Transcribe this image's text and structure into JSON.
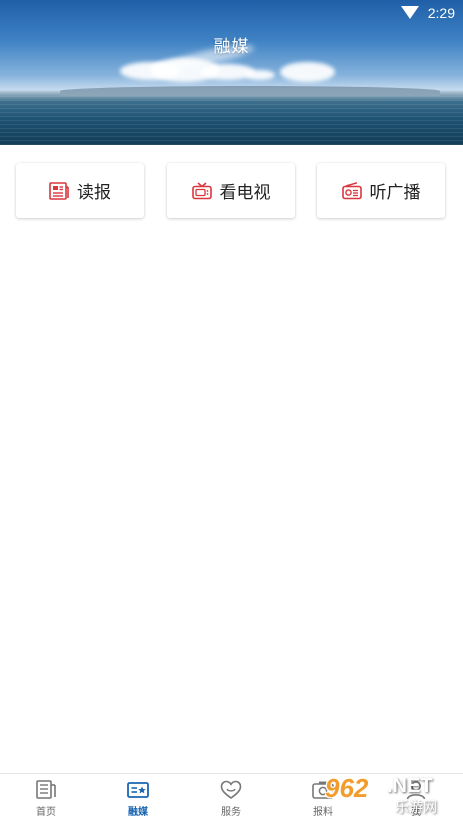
{
  "status_bar": {
    "time": "2:29",
    "wifi_icon": "wifi-icon"
  },
  "header": {
    "title": "融媒"
  },
  "cards": [
    {
      "label": "读报",
      "icon": "newspaper-icon"
    },
    {
      "label": "看电视",
      "icon": "tv-icon"
    },
    {
      "label": "听广播",
      "icon": "radio-icon"
    }
  ],
  "bottom_nav": [
    {
      "label": "首页",
      "icon": "home-icon",
      "active": false
    },
    {
      "label": "融媒",
      "icon": "media-icon",
      "active": true
    },
    {
      "label": "服务",
      "icon": "heart-icon",
      "active": false
    },
    {
      "label": "报料",
      "icon": "camera-icon",
      "active": false
    },
    {
      "label": "我",
      "icon": "user-icon",
      "active": false
    }
  ],
  "watermark": {
    "number": "962",
    "suffix": ".NET",
    "site": "乐游网"
  },
  "colors": {
    "accent": "#1a66b3",
    "icon_red": "#d9363e"
  }
}
